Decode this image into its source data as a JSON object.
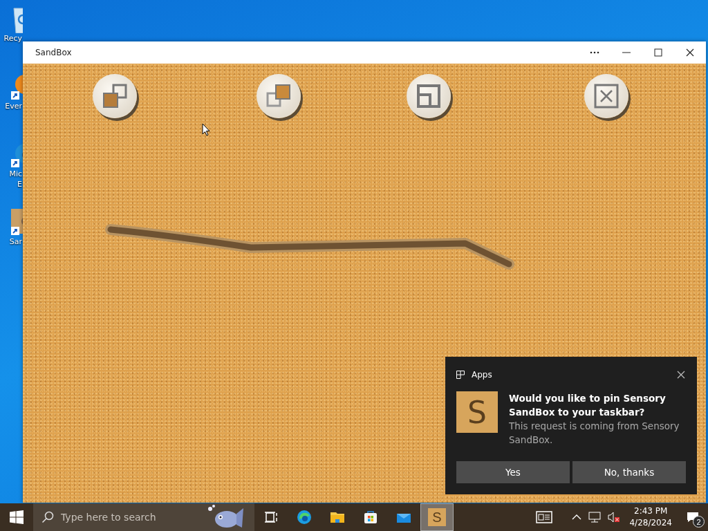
{
  "desktop": {
    "icons": [
      {
        "kind": "recycle_bin",
        "lines": [
          "Recy"
        ]
      },
      {
        "kind": "orange_app",
        "lines": [
          "Ever"
        ]
      },
      {
        "kind": "edge",
        "lines": [
          "Mic",
          "E"
        ]
      },
      {
        "kind": "sandbox",
        "lines": [
          "Sar"
        ]
      }
    ]
  },
  "window": {
    "title": "SandBox",
    "tools": [
      {
        "kind": "send_back"
      },
      {
        "kind": "bring_front"
      },
      {
        "kind": "resize"
      },
      {
        "kind": "close"
      }
    ]
  },
  "notification": {
    "source": "Apps",
    "app_tile": "S",
    "title": "Would you like to pin Sensory SandBox to your taskbar?",
    "body": "This request is coming from Sensory SandBox.",
    "buttons": [
      "Yes",
      "No, thanks"
    ]
  },
  "taskbar": {
    "search": {
      "placeholder": "Type here to search"
    },
    "apps": [
      {
        "kind": "task_view",
        "selected": false
      },
      {
        "kind": "edge",
        "selected": false
      },
      {
        "kind": "explorer",
        "selected": false
      },
      {
        "kind": "store",
        "selected": false
      },
      {
        "kind": "mail",
        "selected": false
      },
      {
        "kind": "sandbox",
        "label": "S",
        "selected": true
      }
    ],
    "tray": {
      "volume_muted": true,
      "time": "2:43 PM",
      "date": "4/28/2024",
      "notifications": "2"
    }
  }
}
